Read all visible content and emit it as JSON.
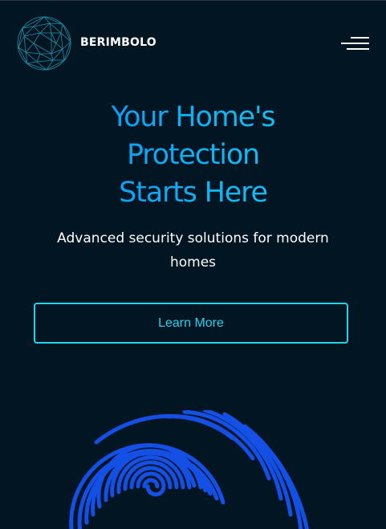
{
  "header": {
    "brand": "BERIMBOLO",
    "logo_icon": "geodesic-sphere-icon",
    "menu_icon": "hamburger-menu-icon"
  },
  "hero": {
    "title_lines": [
      "Your Home's",
      "Protection",
      "Starts Here"
    ],
    "subtitle": "Advanced security solutions for modern homes",
    "cta_label": "Learn More"
  },
  "decor": {
    "fingerprint_icon": "fingerprint-icon"
  },
  "colors": {
    "background": "#021523",
    "title_gradient_start": "#0a8cf2",
    "title_gradient_end": "#12cdf0",
    "cta_border": "#1ad8e8",
    "fingerprint": "#1450e6",
    "logo_lines": "#1f8fa8"
  }
}
